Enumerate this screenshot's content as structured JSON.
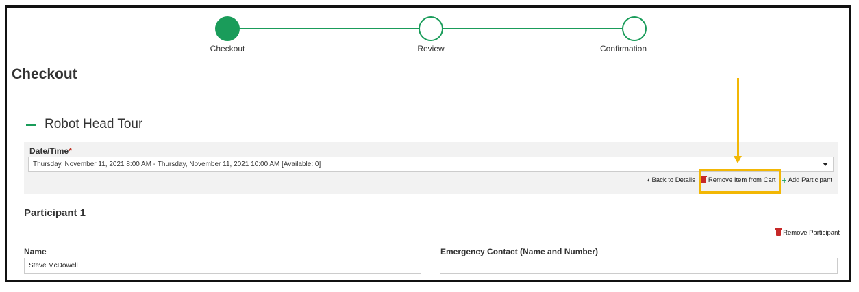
{
  "stepper": {
    "steps": [
      {
        "label": "Checkout",
        "state": "active"
      },
      {
        "label": "Review",
        "state": "pending"
      },
      {
        "label": "Confirmation",
        "state": "pending"
      }
    ],
    "accent_color": "#1a9c5a"
  },
  "page": {
    "title": "Checkout"
  },
  "item": {
    "title": "Robot Head Tour",
    "date_label": "Date/Time",
    "required_mark": "*",
    "date_value": "Thursday, November 11, 2021 8:00 AM - Thursday, November 11, 2021 10:00 AM [Available: 0]",
    "actions": {
      "back": "Back to Details",
      "remove": "Remove Item from Cart",
      "add_participant": "Add Participant"
    }
  },
  "annotation": {
    "highlight_color": "#f2b705"
  },
  "participant": {
    "title": "Participant 1",
    "remove": "Remove Participant",
    "name_label": "Name",
    "name_value": "Steve McDowell",
    "emergency_label": "Emergency Contact (Name and Number)",
    "emergency_value": ""
  }
}
